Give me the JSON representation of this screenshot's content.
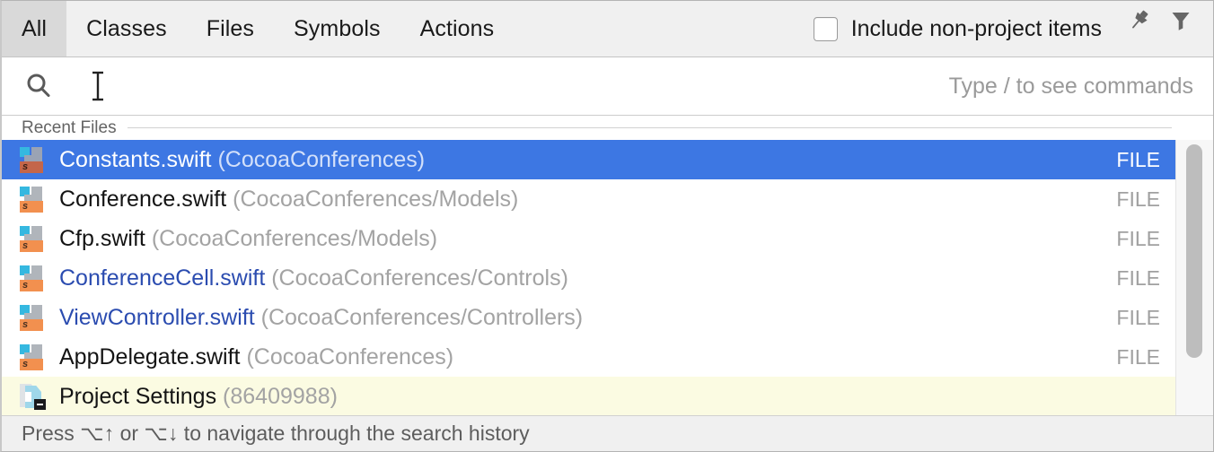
{
  "window": {
    "kind": "search-everywhere-popup"
  },
  "tabs": [
    {
      "label": "All",
      "active": true
    },
    {
      "label": "Classes",
      "active": false
    },
    {
      "label": "Files",
      "active": false
    },
    {
      "label": "Symbols",
      "active": false
    },
    {
      "label": "Actions",
      "active": false
    }
  ],
  "header": {
    "include_non_project_label": "Include non-project items",
    "include_non_project_checked": false,
    "pin_icon": "pin-icon",
    "filter_icon": "filter-icon"
  },
  "search": {
    "value": "",
    "placeholder": "",
    "hint": "Type / to see commands",
    "icon": "search-icon",
    "caret_icon": "text-cursor-icon"
  },
  "group": {
    "title": "Recent Files"
  },
  "results": [
    {
      "icon": "swift-file-icon",
      "name": "Constants.swift",
      "path": "(CocoaConferences)",
      "type": "FILE",
      "selected": true,
      "opened": false,
      "highlight": false
    },
    {
      "icon": "swift-file-icon",
      "name": "Conference.swift",
      "path": "(CocoaConferences/Models)",
      "type": "FILE",
      "selected": false,
      "opened": false,
      "highlight": false
    },
    {
      "icon": "swift-file-icon",
      "name": "Cfp.swift",
      "path": "(CocoaConferences/Models)",
      "type": "FILE",
      "selected": false,
      "opened": false,
      "highlight": false
    },
    {
      "icon": "swift-file-icon",
      "name": "ConferenceCell.swift",
      "path": "(CocoaConferences/Controls)",
      "type": "FILE",
      "selected": false,
      "opened": true,
      "highlight": false
    },
    {
      "icon": "swift-file-icon",
      "name": "ViewController.swift",
      "path": "(CocoaConferences/Controllers)",
      "type": "FILE",
      "selected": false,
      "opened": true,
      "highlight": false
    },
    {
      "icon": "swift-file-icon",
      "name": "AppDelegate.swift",
      "path": "(CocoaConferences)",
      "type": "FILE",
      "selected": false,
      "opened": false,
      "highlight": false
    },
    {
      "icon": "project-settings-icon",
      "name": "Project Settings",
      "path": "(86409988)",
      "type": "",
      "selected": false,
      "opened": false,
      "highlight": true
    }
  ],
  "footer": {
    "hint": "Press ⌥↑ or ⌥↓ to navigate through the search history"
  },
  "colors": {
    "selection": "#3d77e3",
    "highlight_row": "#fbfbe2",
    "opened_file_text": "#2b4cb0",
    "path_text": "#a3a3a3",
    "header_bg": "#f0f0f0",
    "active_tab_bg": "#d9d9d9"
  },
  "scrollbar": {
    "orientation": "vertical",
    "thumb_fraction": 0.72
  }
}
